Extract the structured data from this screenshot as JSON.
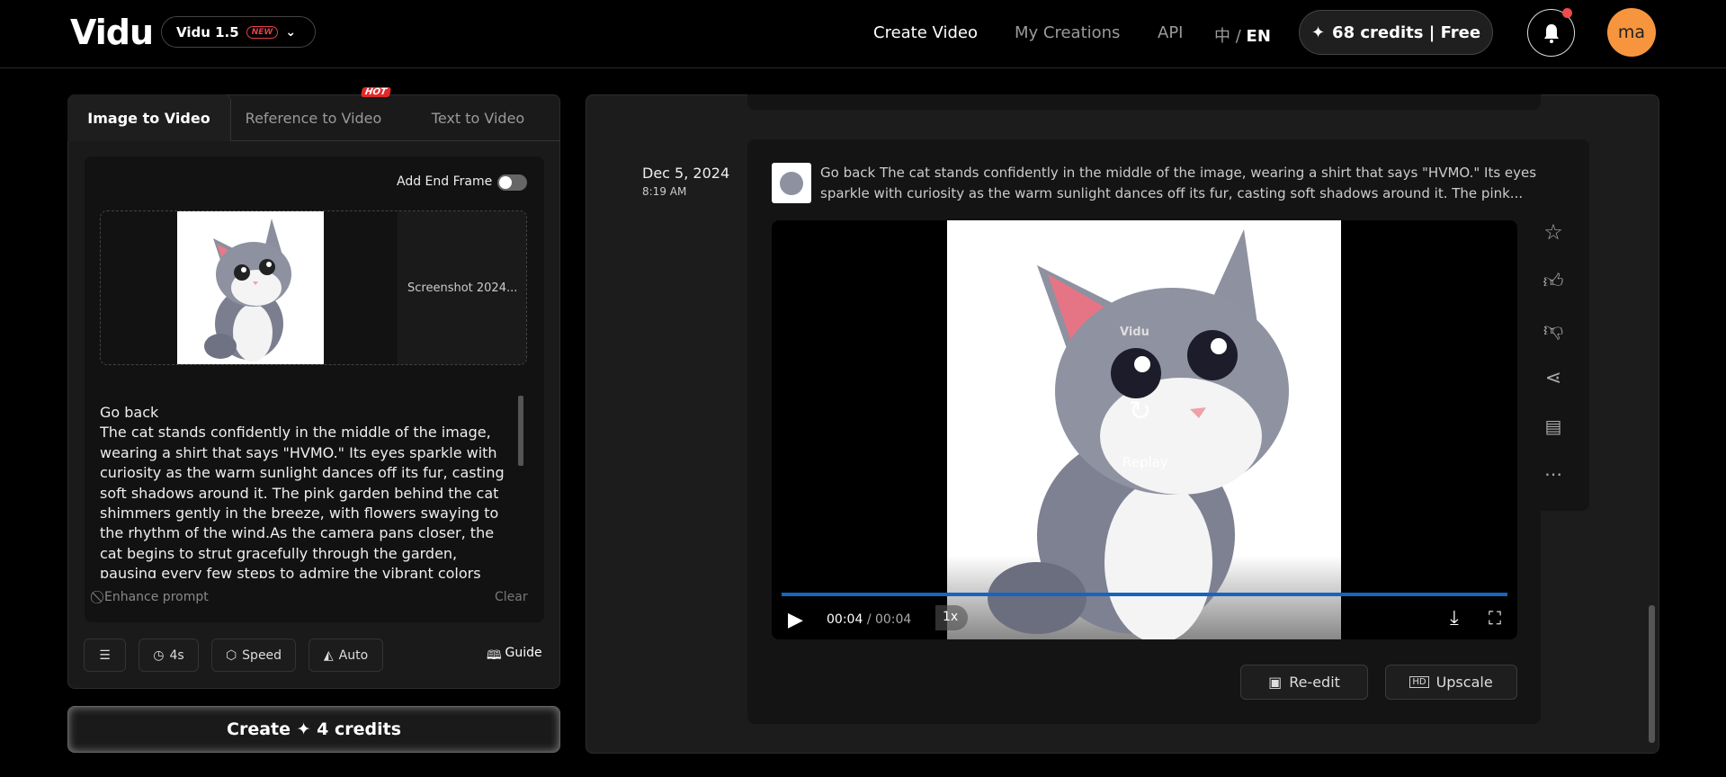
{
  "header": {
    "logo": "Vidu",
    "model": "Vidu 1.5",
    "model_badge": "NEW",
    "nav": [
      "Create Video",
      "My Creations",
      "API"
    ],
    "lang_zh": "中",
    "lang_sep": "/",
    "lang_en": "EN",
    "credits": "68 credits | Free",
    "avatar": "ma",
    "notification_dot_color": "#f04a4a",
    "avatar_color": "#f7953f"
  },
  "left": {
    "tabs": [
      "Image to Video",
      "Reference to Video",
      "Text to Video"
    ],
    "hot_badge": "HOT",
    "add_end_frame": "Add End Frame",
    "add_end_frame_on": false,
    "file_name": "Screenshot 2024...",
    "prompt": "Go back\nThe cat stands confidently in the middle of the image, wearing a shirt that says \"HVMO.\" Its eyes sparkle with curiosity as the warm sunlight dances off its fur, casting soft shadows around it. The pink garden behind the cat shimmers gently in the breeze, with flowers swaying to the rhythm of the wind.As the camera pans closer, the cat begins to strut gracefully through the garden, pausing every few steps to admire the vibrant colors around it. It",
    "enhance": "Enhance prompt",
    "clear": "Clear",
    "duration": "4s",
    "speed": "Speed",
    "auto": "Auto",
    "guide": "Guide",
    "create": "Create ✦ 4 credits"
  },
  "creation": {
    "date": "Dec 5, 2024",
    "time": "8:19 AM",
    "prompt": "Go back The cat stands confidently in the middle of the image, wearing a shirt that says \"HVMO.\" Its eyes sparkle with curiosity as the warm sunlight dances off its fur, casting soft shadows around it. The pink...",
    "watermark": "Vidu",
    "replay": "Replay",
    "current_time": "00:04",
    "duration": "/ 00:04",
    "progress_percent": 100,
    "speed": "1x",
    "reedit": "Re-edit",
    "upscale": "Upscale",
    "progress_color": "#1565c0"
  }
}
